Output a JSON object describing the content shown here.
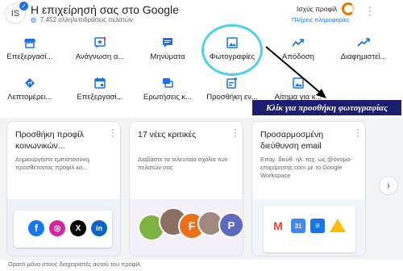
{
  "header": {
    "avatar_text": "IS",
    "title": "Η επιχείρησή σας στο Google",
    "subtitle": "7.452 αλληλεπιδράσεις πελατών",
    "strength_label": "Ισχύς προφίλ",
    "more_info": "Πλήρεις πληροφορίες"
  },
  "actions": [
    {
      "label": "Επεξεργασί...",
      "icon": "storefront-icon"
    },
    {
      "label": "Ανάγνωση α...",
      "icon": "reviews-icon"
    },
    {
      "label": "Μηνύματα",
      "icon": "message-icon"
    },
    {
      "label": "Φωτογραφίες",
      "icon": "photo-icon"
    },
    {
      "label": "Απόδοση",
      "icon": "performance-icon"
    },
    {
      "label": "Διαφημιστεί...",
      "icon": "ads-icon"
    },
    {
      "label": "Λεπτομέρει...",
      "icon": "directions-icon"
    },
    {
      "label": "Επεξεργασί...",
      "icon": "calendar-icon"
    },
    {
      "label": "Ερωτήσεις κ...",
      "icon": "qa-icon"
    },
    {
      "label": "Προσθήκη εν...",
      "icon": "add-update-icon"
    },
    {
      "label": "Αίτημα για κ...",
      "icon": "request-icon"
    }
  ],
  "callout": "Κλίκ για προσθήκη φωτογραφίας",
  "cards": [
    {
      "title": "Προσθήκη προφίλ κοινωνικών...",
      "desc": "Δημιουργήστε εμπιστοσύνη, προσθέτοντας προφίλ κο..."
    },
    {
      "title": "17 νέες κριτικές",
      "desc": "Διαβάστε τα τελευταία σχόλια των πελατών σας"
    },
    {
      "title": "Προσαρμοσμένη διεύθυνση email",
      "desc": "Επαγ. διεύθ. ηλ. ταχ. ως @όνομα-επιχείρησης.com με το Google Workspace"
    }
  ],
  "review_initials": [
    "F",
    "P"
  ],
  "footer": "Ορατό μόνο στους διαχειριστές αυτού του προφίλ",
  "colors": {
    "accent": "#1a73e8",
    "highlight": "#4fd0e8",
    "callout_bg": "#1c1e6f"
  }
}
